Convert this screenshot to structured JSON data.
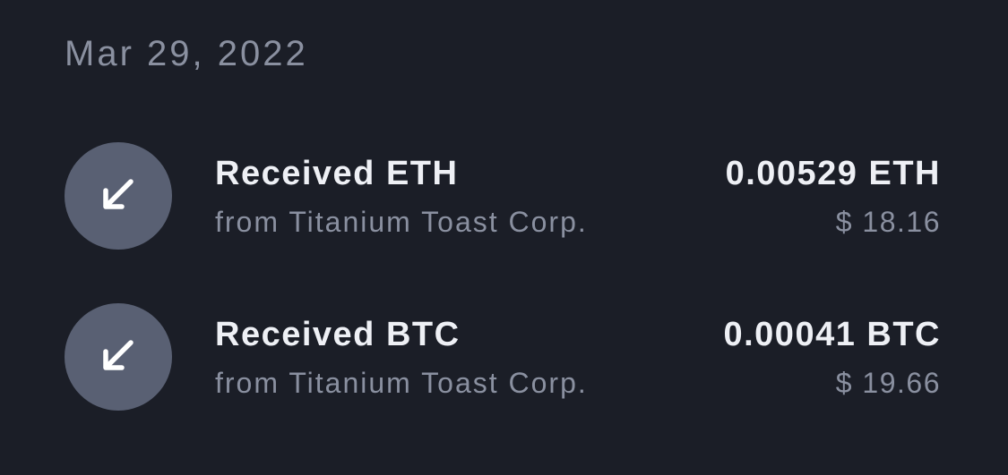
{
  "date_header": "Mar 29, 2022",
  "transactions": [
    {
      "title": "Received ETH",
      "subtitle": "from Titanium Toast Corp.",
      "amount": "0.00529 ETH",
      "fiat": "$ 18.16",
      "icon": "arrow-down-left-icon"
    },
    {
      "title": "Received BTC",
      "subtitle": "from Titanium Toast Corp.",
      "amount": "0.00041 BTC",
      "fiat": "$ 19.66",
      "icon": "arrow-down-left-icon"
    }
  ],
  "colors": {
    "background": "#1b1e27",
    "avatar": "#596073",
    "primary_text": "#eef0f5",
    "secondary_text": "#8a90a0"
  }
}
